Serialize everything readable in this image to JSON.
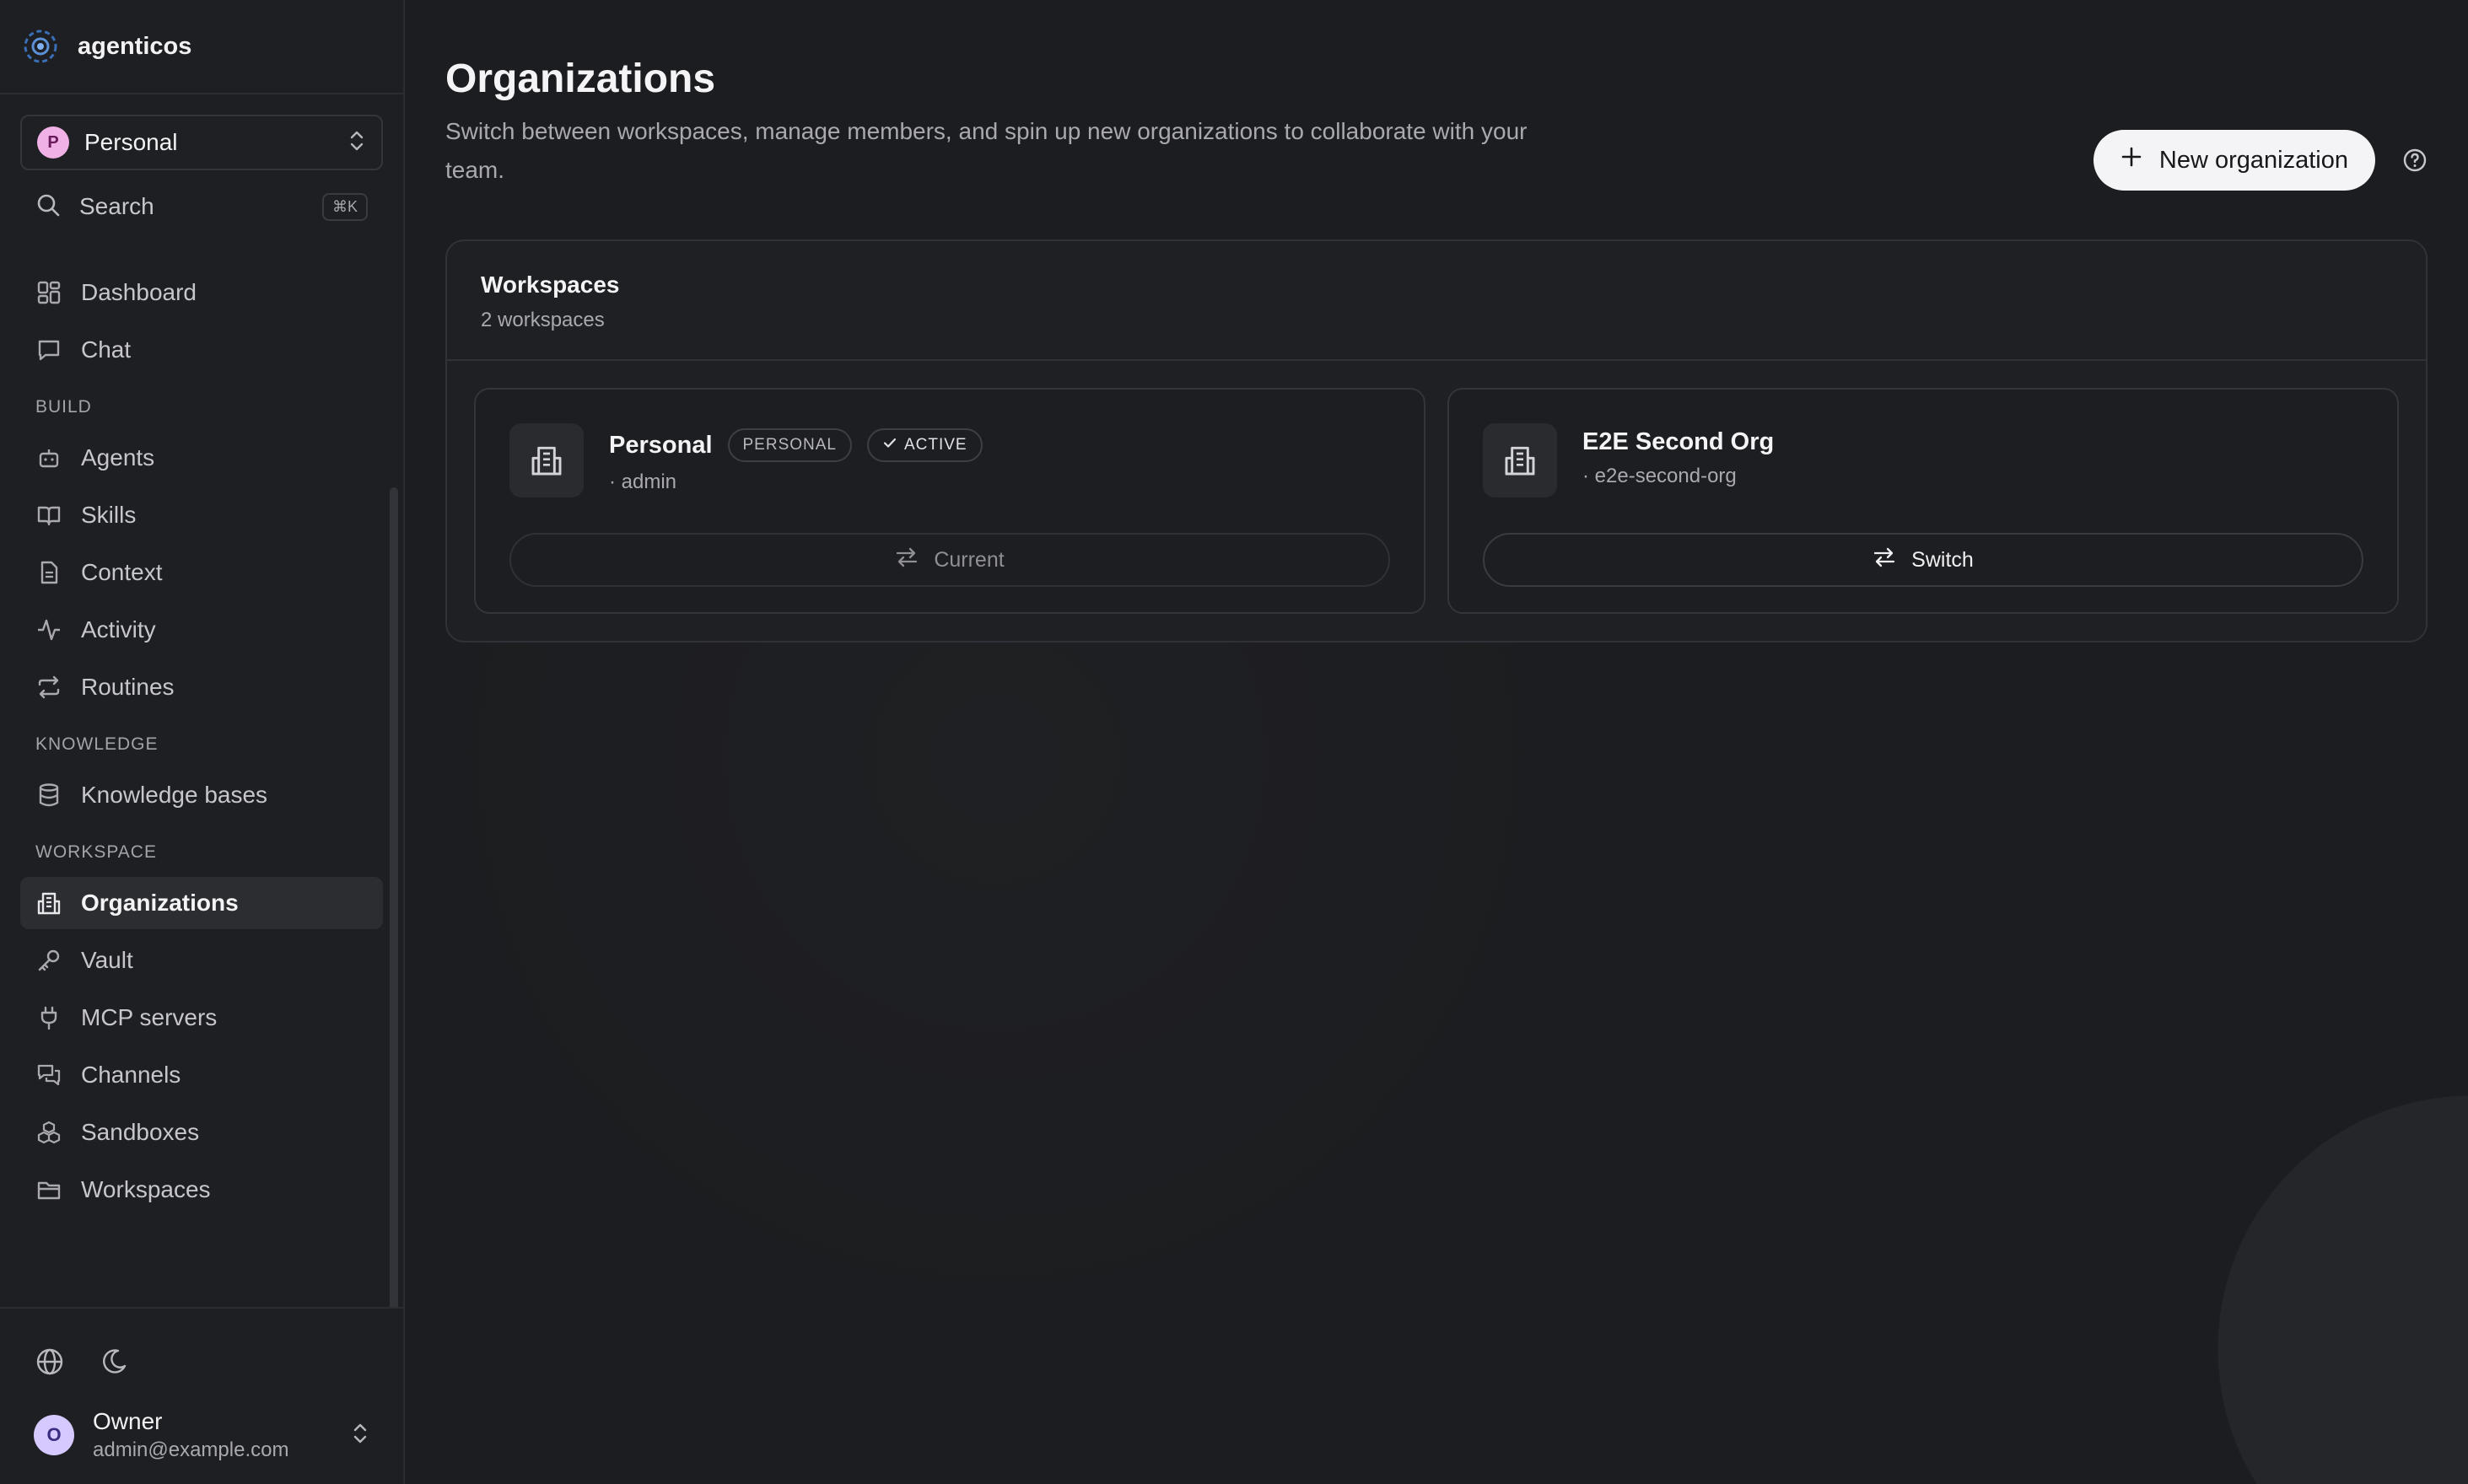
{
  "brand": {
    "name": "agenticos"
  },
  "org_selector": {
    "initial": "P",
    "name": "Personal"
  },
  "search": {
    "label": "Search",
    "shortcut": "⌘K"
  },
  "nav": {
    "top": [
      {
        "label": "Dashboard",
        "icon": "dashboard-icon"
      },
      {
        "label": "Chat",
        "icon": "chat-icon"
      }
    ],
    "build_label": "BUILD",
    "build": [
      {
        "label": "Agents",
        "icon": "robot-icon"
      },
      {
        "label": "Skills",
        "icon": "book-icon"
      },
      {
        "label": "Context",
        "icon": "document-icon"
      },
      {
        "label": "Activity",
        "icon": "activity-icon"
      },
      {
        "label": "Routines",
        "icon": "repeat-icon"
      }
    ],
    "knowledge_label": "KNOWLEDGE",
    "knowledge": [
      {
        "label": "Knowledge bases",
        "icon": "database-icon"
      }
    ],
    "workspace_label": "WORKSPACE",
    "workspace": [
      {
        "label": "Organizations",
        "icon": "building-icon",
        "active": true
      },
      {
        "label": "Vault",
        "icon": "key-icon"
      },
      {
        "label": "MCP servers",
        "icon": "plug-icon"
      },
      {
        "label": "Channels",
        "icon": "messages-icon"
      },
      {
        "label": "Sandboxes",
        "icon": "boxes-icon"
      },
      {
        "label": "Workspaces",
        "icon": "folder-icon"
      }
    ]
  },
  "user": {
    "initial": "O",
    "name": "Owner",
    "email": "admin@example.com"
  },
  "page": {
    "title": "Organizations",
    "subtitle": "Switch between workspaces, manage members, and spin up new organizations to collaborate with your team.",
    "new_button": "New organization"
  },
  "panel": {
    "title": "Workspaces",
    "count": "2 workspaces",
    "cards": [
      {
        "name": "Personal",
        "badge_type": "PERSONAL",
        "badge_status": "ACTIVE",
        "sub": "· admin",
        "button": "Current"
      },
      {
        "name": "E2E Second Org",
        "sub": "· e2e-second-org",
        "button": "Switch"
      }
    ]
  },
  "colors": {
    "accent": "#f4f4f6",
    "background": "#1c1d20",
    "sidebar": "#1e1f22",
    "org_dot": "#f0b2e6",
    "user_avatar": "#d6c9ff"
  }
}
